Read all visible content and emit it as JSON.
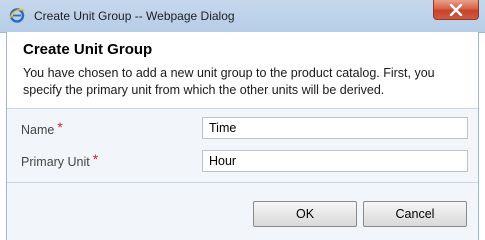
{
  "window": {
    "title": "Create Unit Group -- Webpage Dialog",
    "app_icon": "ie-icon",
    "close_icon": "close-icon"
  },
  "dialog": {
    "heading": "Create Unit Group",
    "description": "You have chosen to add a new unit group to the product catalog. First, you specify the primary unit from which the other units will be derived."
  },
  "form": {
    "name_label": "Name",
    "name_value": "Time",
    "primary_unit_label": "Primary Unit",
    "primary_unit_value": "Hour",
    "required_marker": "*"
  },
  "buttons": {
    "ok": "OK",
    "cancel": "Cancel"
  }
}
